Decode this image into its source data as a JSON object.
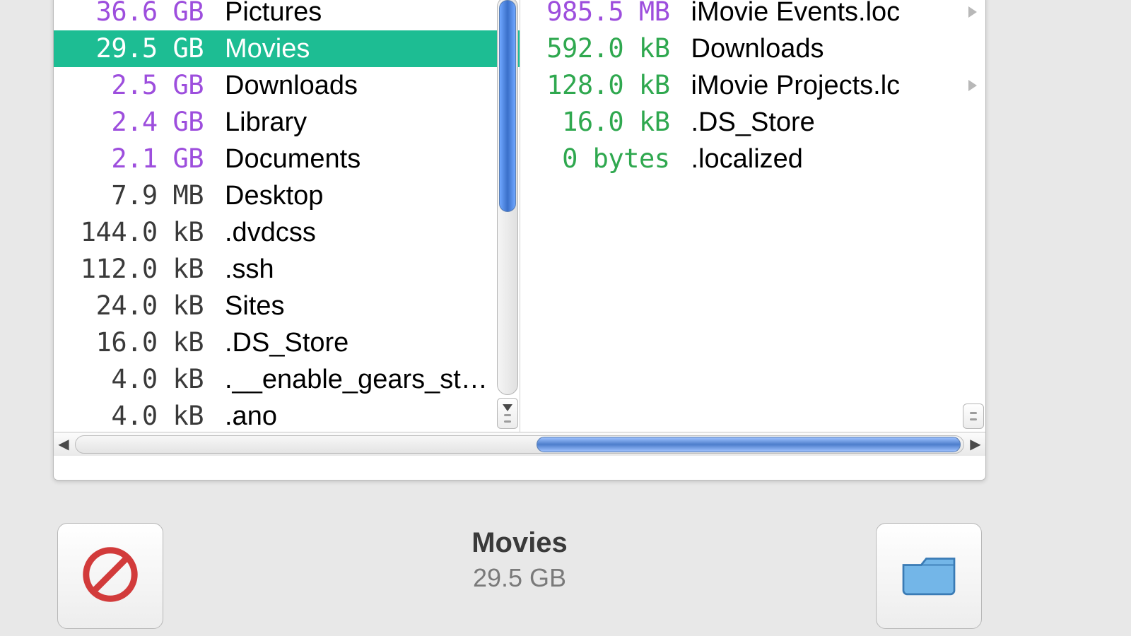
{
  "colors": {
    "selection": "#1dbd93",
    "size_purple": "#9d4edd",
    "size_green": "#2fa84f"
  },
  "left_column": {
    "items": [
      {
        "size": "36.6 GB",
        "name": "Pictures",
        "arrow": true,
        "selected": false,
        "size_class": "sz-purple"
      },
      {
        "size": "29.5 GB",
        "name": "Movies",
        "arrow": true,
        "selected": true,
        "size_class": "sz-purple"
      },
      {
        "size": "2.5 GB",
        "name": "Downloads",
        "arrow": true,
        "selected": false,
        "size_class": "sz-purple"
      },
      {
        "size": "2.4 GB",
        "name": "Library",
        "arrow": true,
        "selected": false,
        "size_class": "sz-purple"
      },
      {
        "size": "2.1 GB",
        "name": "Documents",
        "arrow": true,
        "selected": false,
        "size_class": "sz-purple"
      },
      {
        "size": "7.9 MB",
        "name": "Desktop",
        "arrow": true,
        "selected": false,
        "size_class": "sz-black"
      },
      {
        "size": "144.0 kB",
        "name": ".dvdcss",
        "arrow": true,
        "selected": false,
        "size_class": "sz-black"
      },
      {
        "size": "112.0 kB",
        "name": ".ssh",
        "arrow": true,
        "selected": false,
        "size_class": "sz-black"
      },
      {
        "size": "24.0 kB",
        "name": "Sites",
        "arrow": true,
        "selected": false,
        "size_class": "sz-black"
      },
      {
        "size": "16.0 kB",
        "name": ".DS_Store",
        "arrow": false,
        "selected": false,
        "size_class": "sz-black"
      },
      {
        "size": "4.0 kB",
        "name": ".__enable_gears_st…",
        "arrow": false,
        "selected": false,
        "size_class": "sz-black"
      },
      {
        "size": "4.0 kB",
        "name": ".ano",
        "arrow": false,
        "selected": false,
        "size_class": "sz-black"
      }
    ]
  },
  "right_column": {
    "items": [
      {
        "size": "985.5 MB",
        "name": "iMovie Events.loc",
        "arrow": true,
        "selected": false,
        "size_class": "sz-purple"
      },
      {
        "size": "592.0 kB",
        "name": "Downloads",
        "arrow": false,
        "selected": false,
        "size_class": "sz-green"
      },
      {
        "size": "128.0 kB",
        "name": "iMovie Projects.lc",
        "arrow": true,
        "selected": false,
        "size_class": "sz-green"
      },
      {
        "size": "16.0 kB",
        "name": ".DS_Store",
        "arrow": false,
        "selected": false,
        "size_class": "sz-green"
      },
      {
        "size": "0 bytes",
        "name": ".localized",
        "arrow": false,
        "selected": false,
        "size_class": "sz-green"
      }
    ]
  },
  "status": {
    "title": "Movies",
    "subtitle": "29.5 GB"
  },
  "icons": {
    "deny": "deny-icon",
    "folder": "folder-icon"
  }
}
